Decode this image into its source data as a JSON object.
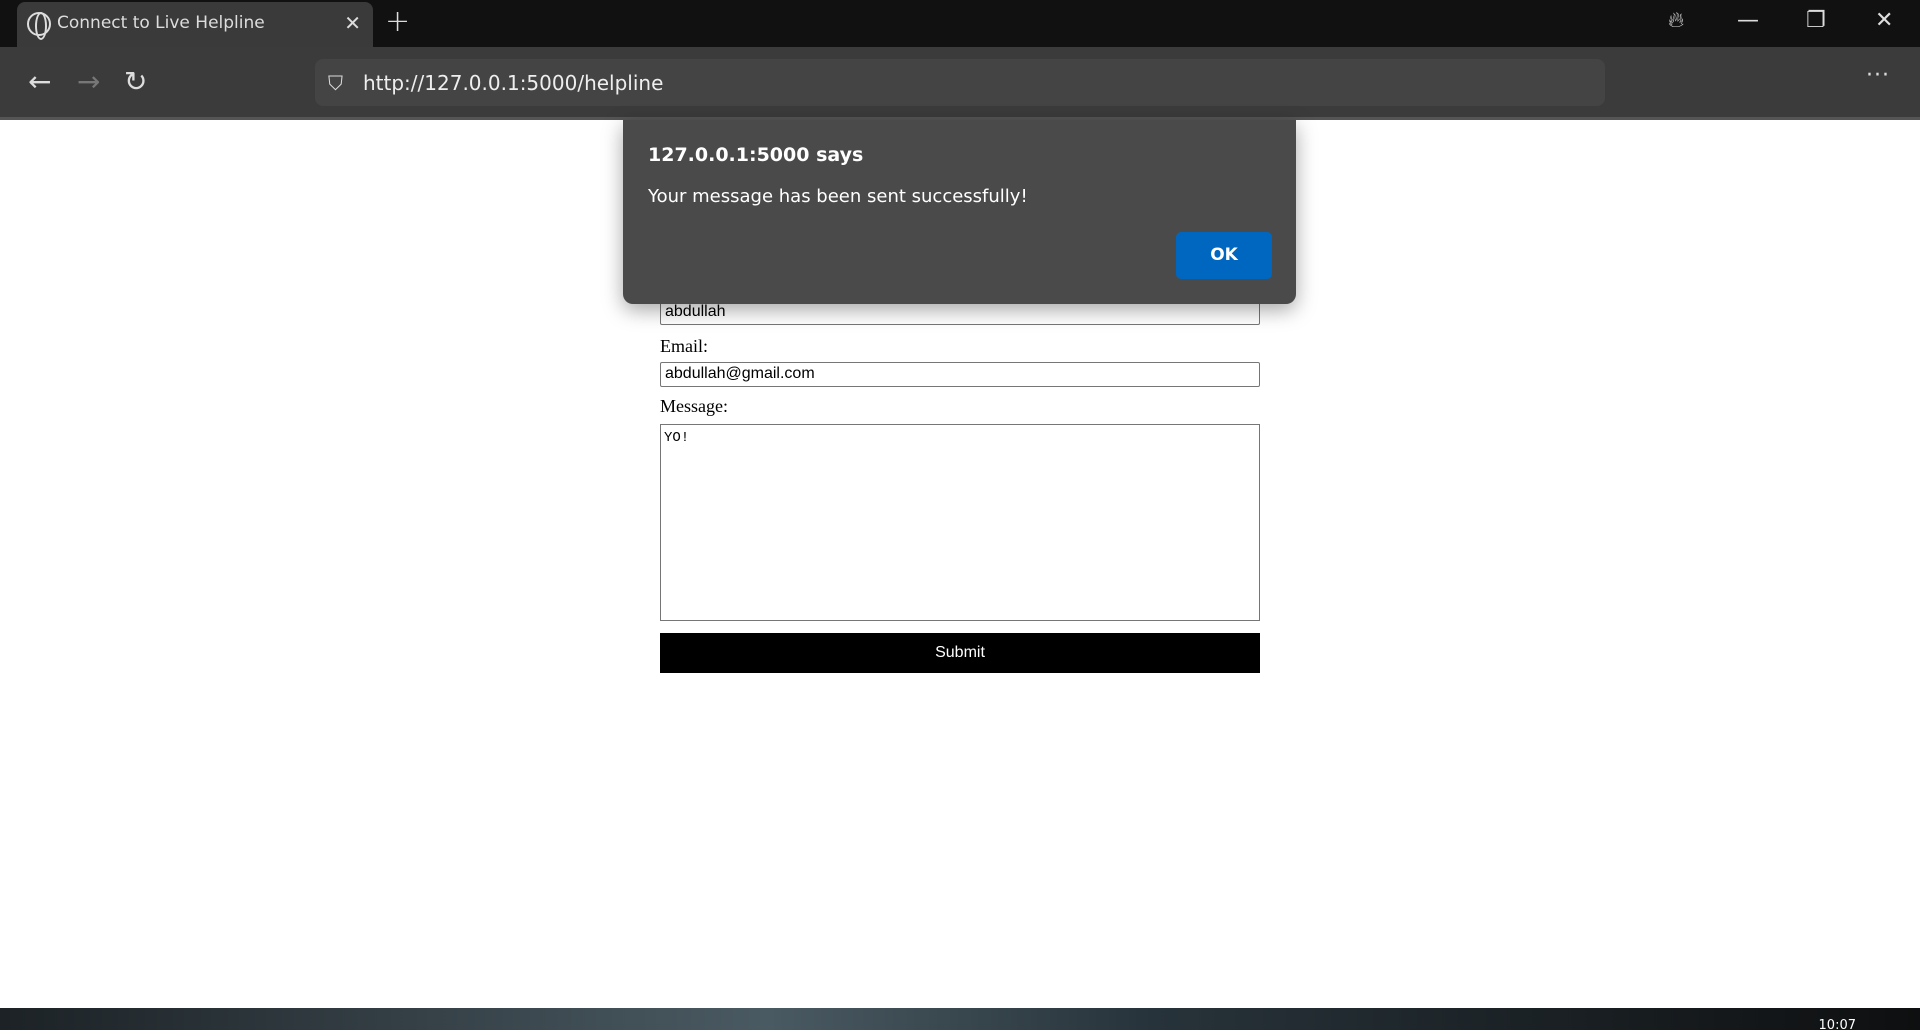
{
  "browser": {
    "tab_title": "Connect to Live Helpline",
    "url": "http://127.0.0.1:5000/helpline"
  },
  "form": {
    "name_value": "abdullah",
    "email_label": "Email:",
    "email_value": "abdullah@gmail.com",
    "message_label": "Message:",
    "message_value": "YO!",
    "submit_label": "Submit"
  },
  "dialog": {
    "title": "127.0.0.1:5000 says",
    "message": "Your message has been sent successfully!",
    "ok_label": "OK",
    "accent": "#0067c0"
  },
  "taskbar": {
    "clock": "10:07"
  }
}
